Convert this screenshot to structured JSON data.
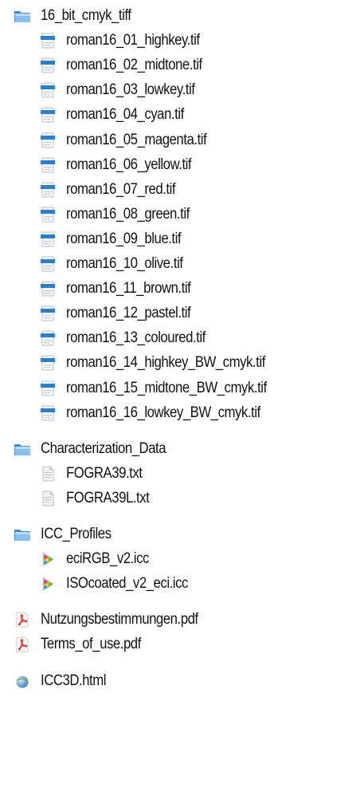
{
  "groups": [
    {
      "folder": "16_bit_cmyk_tiff",
      "folder_icon": "folder-icon",
      "files": [
        {
          "name": "roman16_01_highkey.tif",
          "icon": "tif-file-icon"
        },
        {
          "name": "roman16_02_midtone.tif",
          "icon": "tif-file-icon"
        },
        {
          "name": "roman16_03_lowkey.tif",
          "icon": "tif-file-icon"
        },
        {
          "name": "roman16_04_cyan.tif",
          "icon": "tif-file-icon"
        },
        {
          "name": "roman16_05_magenta.tif",
          "icon": "tif-file-icon"
        },
        {
          "name": "roman16_06_yellow.tif",
          "icon": "tif-file-icon"
        },
        {
          "name": "roman16_07_red.tif",
          "icon": "tif-file-icon"
        },
        {
          "name": "roman16_08_green.tif",
          "icon": "tif-file-icon"
        },
        {
          "name": "roman16_09_blue.tif",
          "icon": "tif-file-icon"
        },
        {
          "name": "roman16_10_olive.tif",
          "icon": "tif-file-icon"
        },
        {
          "name": "roman16_11_brown.tif",
          "icon": "tif-file-icon"
        },
        {
          "name": "roman16_12_pastel.tif",
          "icon": "tif-file-icon"
        },
        {
          "name": "roman16_13_coloured.tif",
          "icon": "tif-file-icon"
        },
        {
          "name": "roman16_14_highkey_BW_cmyk.tif",
          "icon": "tif-file-icon"
        },
        {
          "name": "roman16_15_midtone_BW_cmyk.tif",
          "icon": "tif-file-icon"
        },
        {
          "name": "roman16_16_lowkey_BW_cmyk.tif",
          "icon": "tif-file-icon"
        }
      ]
    },
    {
      "folder": "Characterization_Data",
      "folder_icon": "folder-icon",
      "files": [
        {
          "name": "FOGRA39.txt",
          "icon": "txt-file-icon"
        },
        {
          "name": "FOGRA39L.txt",
          "icon": "txt-file-icon"
        }
      ]
    },
    {
      "folder": "ICC_Profiles",
      "folder_icon": "folder-icon",
      "files": [
        {
          "name": "eciRGB_v2.icc",
          "icon": "icc-profile-icon"
        },
        {
          "name": "ISOcoated_v2_eci.icc",
          "icon": "icc-profile-icon"
        }
      ]
    }
  ],
  "root_files": [
    {
      "name": "Nutzungsbestimmungen.pdf",
      "icon": "pdf-file-icon"
    },
    {
      "name": "Terms_of_use.pdf",
      "icon": "pdf-file-icon"
    },
    {
      "name": "ICC3D.html",
      "icon": "html-file-icon"
    }
  ],
  "colors": {
    "folder": "#7fb4e2",
    "folder_dark": "#4a88c6",
    "pdf_red": "#d9342b",
    "text": "#111111"
  }
}
